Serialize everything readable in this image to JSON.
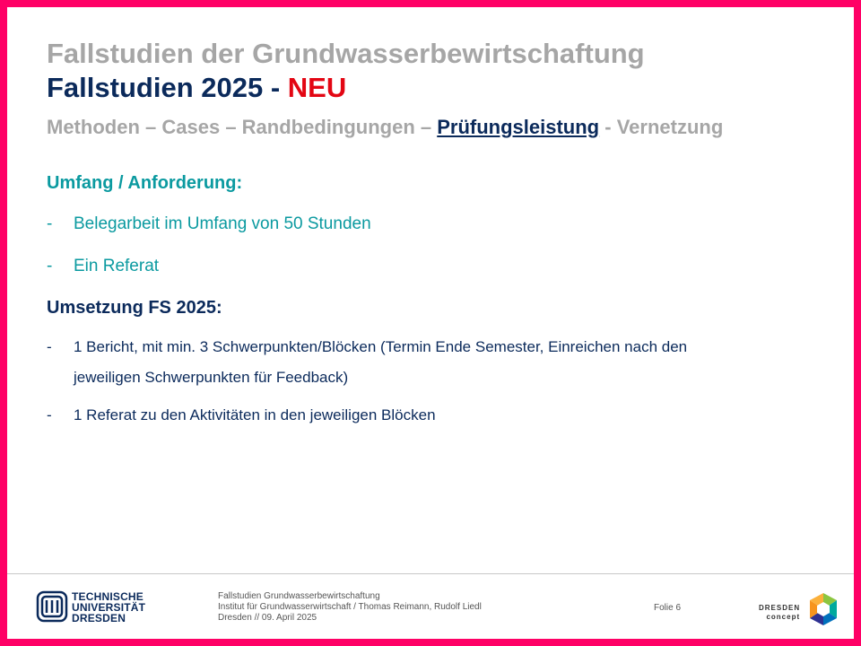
{
  "header": {
    "title": "Fallstudien der Grundwasserbewirtschaftung",
    "subtitle_main": "Fallstudien 2025 -",
    "subtitle_highlight": "NEU"
  },
  "nav": {
    "item1": "Methoden",
    "sep1": " – ",
    "item2": "Cases",
    "sep2": " – ",
    "item3": "Randbedingungen",
    "sep3": " – ",
    "item_active": "Prüfungsleistung",
    "sep4": " - ",
    "item5": "Vernetzung"
  },
  "section1": {
    "heading": "Umfang / Anforderung:",
    "bullets": [
      "Belegarbeit im Umfang von 50 Stunden",
      "Ein Referat"
    ]
  },
  "section2": {
    "heading": "Umsetzung  FS 2025:",
    "bullets": [
      {
        "line1": "1 Bericht, mit min. 3 Schwerpunkten/Blöcken (Termin Ende Semester, Einreichen nach den",
        "line2": "jeweiligen Schwerpunkten für Feedback)"
      },
      {
        "line1": "1 Referat zu den Aktivitäten in den jeweiligen Blöcken"
      }
    ]
  },
  "bullet_dash": "-",
  "footer": {
    "university_lines": [
      "TECHNISCHE",
      "UNIVERSITÄT",
      "DRESDEN"
    ],
    "course": "Fallstudien Grundwasserbewirtschaftung",
    "institute": "Institut für Grundwasserwirtschaft / Thomas Reimann, Rudolf Liedl",
    "date": "Dresden // 09. April 2025",
    "slide_label": "Folie 6",
    "concept_lines": [
      "DRESDEN",
      "concept"
    ]
  },
  "colors": {
    "frame": "#ff0066",
    "navy": "#0b2a5b",
    "teal": "#0b9aa0",
    "gray": "#a6a6a6",
    "red": "#e30613"
  }
}
